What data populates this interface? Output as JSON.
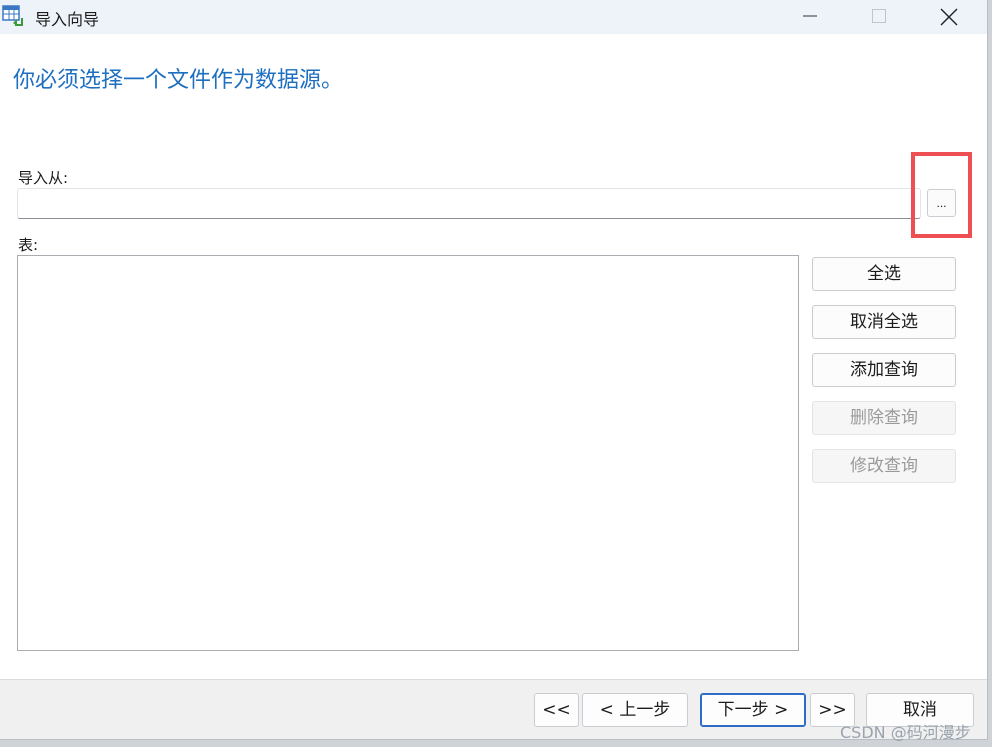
{
  "window": {
    "title": "导入向导",
    "app_icon": "table-import-icon"
  },
  "page": {
    "heading": "你必须选择一个文件作为数据源。"
  },
  "import_from": {
    "label": "导入从:",
    "value": "",
    "placeholder": "",
    "browse_label": "..."
  },
  "tables": {
    "label": "表:",
    "items": []
  },
  "side_buttons": {
    "select_all": "全选",
    "deselect_all": "取消全选",
    "add_query": "添加查询",
    "delete_query": "删除查询",
    "modify_query": "修改查询"
  },
  "footer": {
    "first": "<<",
    "prev": "< 上一步",
    "next": "下一步 >",
    "last": ">>",
    "cancel": "取消"
  },
  "watermark": "CSDN @码河漫步",
  "colors": {
    "heading": "#1e6fbf",
    "highlight": "#ee4f52",
    "titlebar": "#eef3f9"
  }
}
